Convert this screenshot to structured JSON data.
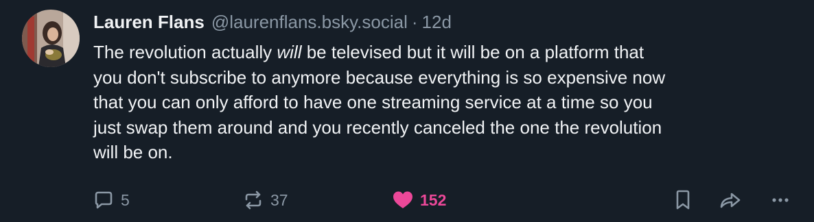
{
  "post": {
    "author": {
      "display_name": "Lauren Flans",
      "handle": "@laurenflans.bsky.social",
      "separator": "·",
      "time": "12d"
    },
    "text": {
      "line1_before": "The revolution actually ",
      "line1_em": "will",
      "line1_after": " be televised but it will be on a platform that",
      "line2": "you don't subscribe to anymore because everything is so expensive now",
      "line3": "that you can only afford to have one streaming service at a time so you",
      "line4": "just swap them around and you recently canceled the one the revolution",
      "line5": "will be on."
    },
    "actions": {
      "reply_count": "5",
      "repost_count": "37",
      "like_count": "152"
    },
    "icons": {
      "reply": "speech-bubble-icon",
      "repost": "repost-arrows-icon",
      "like": "heart-icon",
      "bookmark": "bookmark-icon",
      "share": "share-arrow-icon",
      "more": "ellipsis-icon"
    },
    "colors": {
      "background": "#161e27",
      "text": "#f1f3f5",
      "muted": "#8b98a5",
      "like_accent": "#ec4899"
    }
  }
}
